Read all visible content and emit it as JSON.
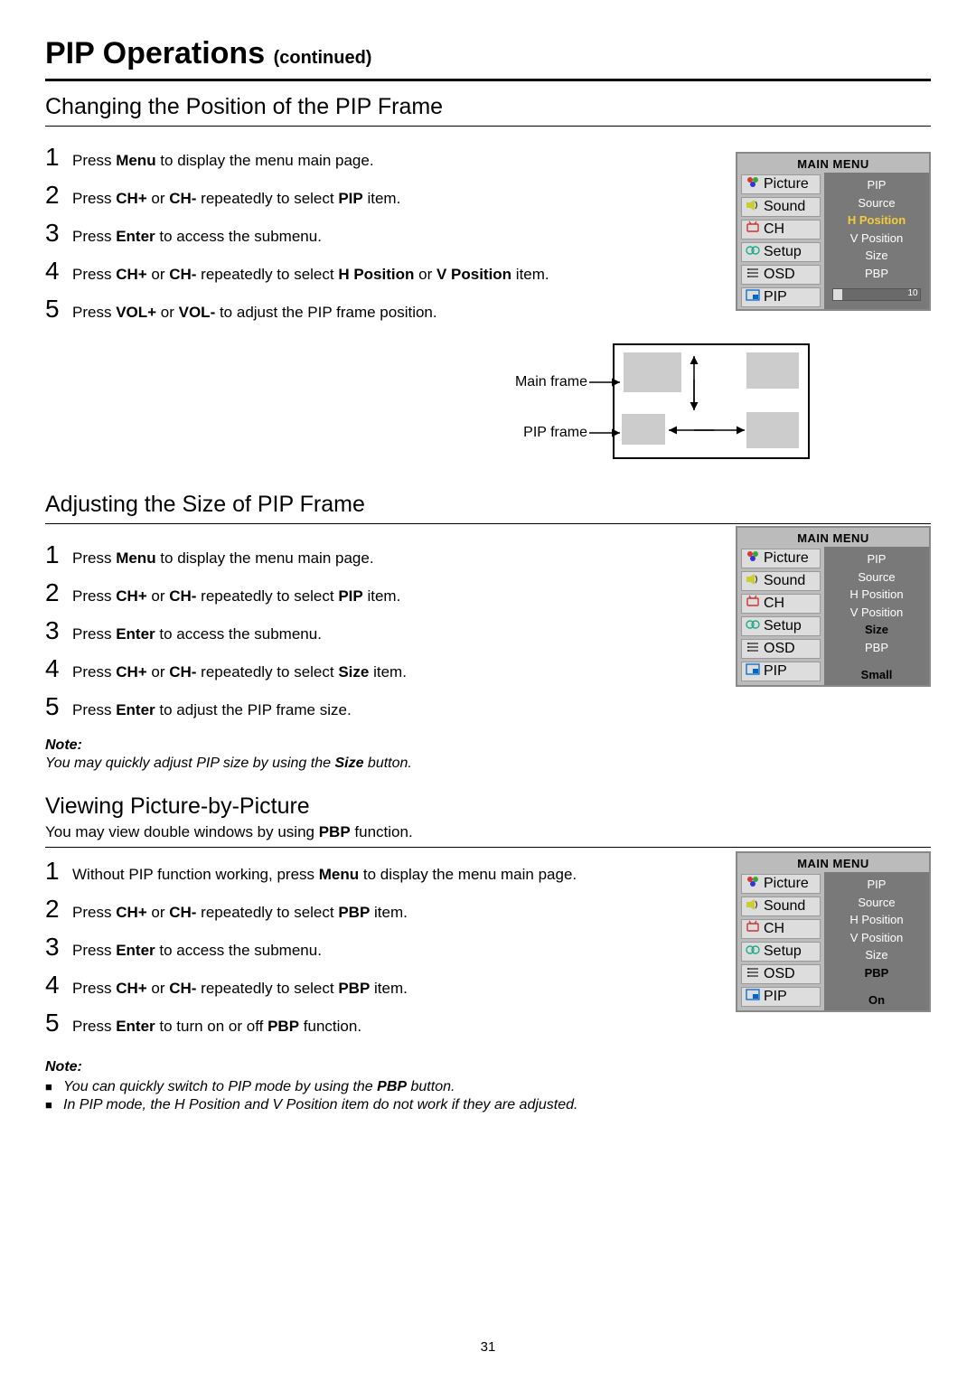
{
  "page": {
    "title_main": "PIP Operations",
    "title_sub": "(continued)",
    "number": "31"
  },
  "section1": {
    "heading": "Changing the Position of the PIP Frame",
    "steps": [
      "Press <b>Menu</b> to display the menu main page.",
      "Press <b>CH+</b> or <b>CH-</b> repeatedly to select <b>PIP</b> item.",
      "Press <b>Enter</b> to access the submenu.",
      "Press <b>CH+</b> or <b>CH-</b> repeatedly to select <b>H Position</b> or <b>V Position</b> item.",
      "Press <b>VOL+</b> or <b>VOL-</b> to adjust the PIP frame position."
    ]
  },
  "diagram": {
    "label_main": "Main frame",
    "label_pip": "PIP frame"
  },
  "section2": {
    "heading": "Adjusting the Size of PIP Frame",
    "steps": [
      "Press <b>Menu</b> to display the menu main page.",
      "Press <b>CH+</b> or <b>CH-</b> repeatedly to select <b>PIP</b> item.",
      "Press <b>Enter</b> to access the submenu.",
      "Press <b>CH+</b> or <b>CH-</b> repeatedly to select <b>Size</b> item.",
      "Press <b>Enter</b> to adjust the PIP frame size."
    ],
    "note_label": "Note:",
    "note_body": "You may quickly adjust PIP size by using the <b>Size</b> button."
  },
  "section3": {
    "heading": "Viewing Picture-by-Picture",
    "intro": "You may view double windows by using <b>PBP</b> function.",
    "steps": [
      "Without PIP function working, press <b>Menu</b> to display the menu main page.",
      "Press <b>CH+</b> or <b>CH-</b> repeatedly to select <b>PBP</b> item.",
      "Press <b>Enter</b> to access the submenu.",
      "Press <b>CH+</b> or <b>CH-</b> repeatedly to select <b>PBP</b> item.",
      "Press <b>Enter</b> to turn on or off <b>PBP</b> function."
    ],
    "note_label": "Note:",
    "note_bullets": [
      "You can quickly switch to PIP mode by using the <b>PBP</b> button.",
      "In PIP mode, the H Position and V Position item do not work if they are adjusted."
    ]
  },
  "menu": {
    "title": "MAIN MENU",
    "left": [
      "Picture",
      "Sound",
      "CH",
      "Setup",
      "OSD",
      "PIP"
    ],
    "right_common": [
      "PIP",
      "Source",
      "H Position",
      "V Position",
      "Size",
      "PBP"
    ],
    "box1_highlight": "H Position",
    "box1_slider_val": "10",
    "box2_highlight": "Size",
    "box2_value": "Small",
    "box3_highlight": "PBP",
    "box3_value": "On"
  }
}
